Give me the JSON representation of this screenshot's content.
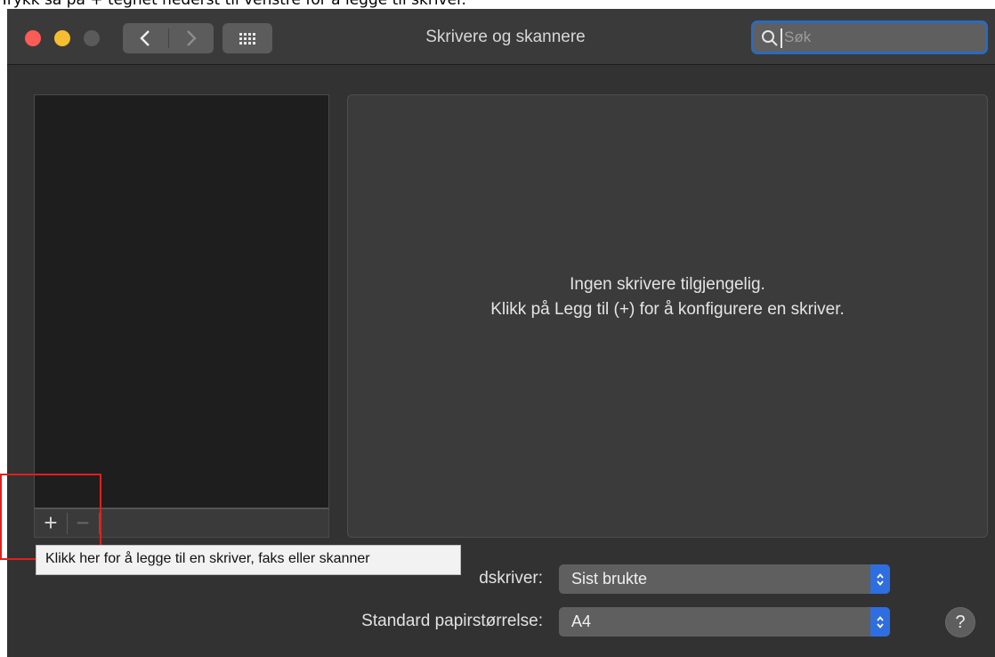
{
  "caption": "Trykk så på + tegnet nederst til venstre for å legge til skriver.",
  "window": {
    "title": "Skrivere og skannere",
    "search_placeholder": "Søk"
  },
  "printer_list": {
    "add_symbol": "+",
    "remove_symbol": "−"
  },
  "detail": {
    "empty_line1": "Ingen skrivere tilgjengelig.",
    "empty_line2": "Klikk på Legg til (+) for å konfigurere en skriver."
  },
  "tooltip": "Klikk her for å legge til en skriver, faks eller skanner",
  "settings": {
    "default_printer_label": "Standardskriver:",
    "default_printer_label_visible": "dskriver:",
    "default_printer_value": "Sist brukte",
    "paper_size_label": "Standard papirstørrelse:",
    "paper_size_value": "A4"
  },
  "help_symbol": "?",
  "colors": {
    "window_bg": "#323232",
    "accent": "#2f6ee0",
    "highlight_box": "#e0201d",
    "close": "#fd5b55",
    "minimize": "#f5bd30"
  }
}
